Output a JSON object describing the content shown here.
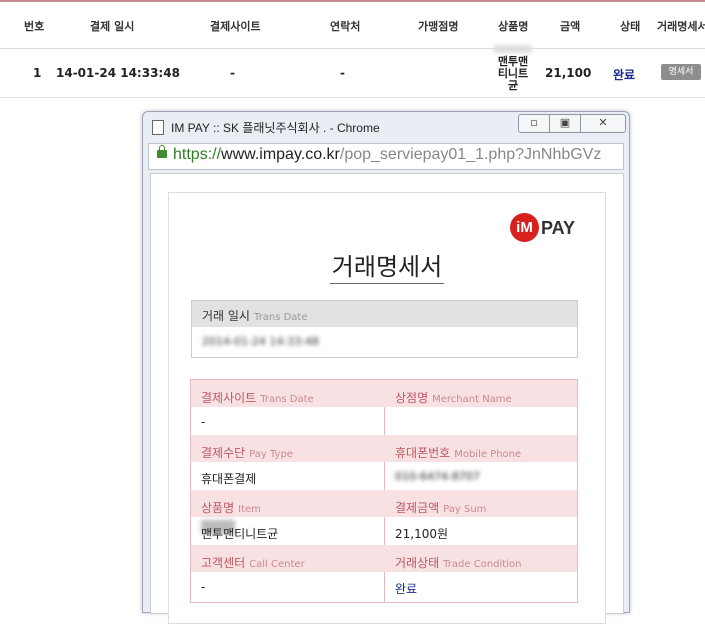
{
  "table": {
    "headers": [
      "번호",
      "결제 일시",
      "결제사이트",
      "연락처",
      "가맹점명",
      "상품명",
      "금액",
      "상태",
      "거래명세서"
    ],
    "row": {
      "no": "1",
      "datetime": "14-01-24 14:33:48",
      "site": "-",
      "contact": "-",
      "merchant": "",
      "product_lines": [
        "맨투맨",
        "티니트",
        "균"
      ],
      "amount": "21,100",
      "status": "완료",
      "receipt_button": "명세서"
    }
  },
  "popup": {
    "window_title": "IM PAY :: SK 플래닛주식회사 . - Chrome",
    "url_protocol": "https://",
    "url_host": "www.impay.co.kr",
    "url_path": "/pop_serviepay01_1.php?JnNhbGVz",
    "logo_im": "iM",
    "logo_pay": "PAY",
    "doc_title": "거래명세서",
    "trans_date_label": "거래 일시",
    "trans_date_sub": "Trans Date",
    "trans_date_value": "2014-01-24 14:33:48",
    "fields": [
      {
        "label": "결제사이트",
        "sub": "Trans Date",
        "value": "-"
      },
      {
        "label": "상점명",
        "sub": "Merchant Name",
        "value": ""
      },
      {
        "label": "결제수단",
        "sub": "Pay Type",
        "value": "휴대폰결제"
      },
      {
        "label": "휴대폰번호",
        "sub": "Mobile Phone",
        "value": "010-6474-8707"
      },
      {
        "label": "상품명",
        "sub": "Item",
        "value": "맨투맨티니트균"
      },
      {
        "label": "결제금액",
        "sub": "Pay Sum",
        "value": "21,100원"
      },
      {
        "label": "고객센터",
        "sub": "Call Center",
        "value": "-"
      },
      {
        "label": "거래상태",
        "sub": "Trade Condition",
        "value": "완료"
      }
    ]
  },
  "colors": {
    "status": "#1a2a8c",
    "badge": "#8d8d8d",
    "field_label": "#c0575f",
    "url_green": "#2f7d25"
  }
}
